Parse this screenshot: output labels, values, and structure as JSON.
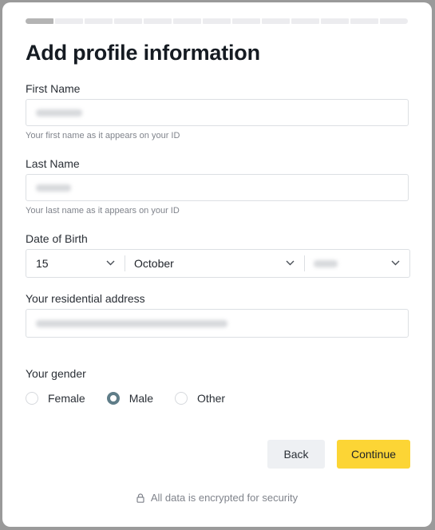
{
  "progress": {
    "total_steps": 13,
    "current_step": 1
  },
  "title": "Add profile information",
  "first_name": {
    "label": "First Name",
    "value": "",
    "help": "Your first name as it appears on your ID"
  },
  "last_name": {
    "label": "Last Name",
    "value": "",
    "help": "Your last name as it appears on your ID"
  },
  "dob": {
    "label": "Date of Birth",
    "day": "15",
    "month": "October",
    "year": ""
  },
  "address": {
    "label": "Your residential address",
    "value": ""
  },
  "gender": {
    "label": "Your gender",
    "options": [
      "Female",
      "Male",
      "Other"
    ],
    "selected": "Male"
  },
  "buttons": {
    "back": "Back",
    "continue": "Continue"
  },
  "footer": {
    "text": "All data is encrypted for security",
    "icon": "lock-icon"
  },
  "colors": {
    "accent": "#fcd535",
    "radio_selected": "#5f7d88"
  }
}
